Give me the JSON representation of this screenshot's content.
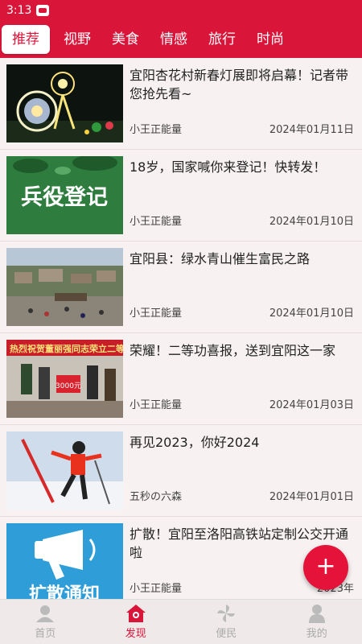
{
  "status_bar": {
    "time": "3:13"
  },
  "tabs": [
    {
      "label": "推荐",
      "active": true
    },
    {
      "label": "视野"
    },
    {
      "label": "美食"
    },
    {
      "label": "情感"
    },
    {
      "label": "旅行"
    },
    {
      "label": "时尚"
    }
  ],
  "articles": [
    {
      "title": "宜阳杏花村新春灯展即将启幕！记者带您抢先看~",
      "source": "小王正能量",
      "date": "2024年01月11日"
    },
    {
      "title": "18岁，国家喊你来登记！快转发！",
      "source": "小王正能量",
      "date": "2024年01月10日",
      "image_text": "兵役登记"
    },
    {
      "title": "宜阳县：绿水青山催生富民之路",
      "source": "小王正能量",
      "date": "2024年01月10日"
    },
    {
      "title": "荣耀！二等功喜报，送到宜阳这一家",
      "source": "小王正能量",
      "date": "2024年01月03日",
      "image_text": "热烈祝贺董丽强同志荣立二等功",
      "image_subtext": "3000元"
    },
    {
      "title": "再见2023，你好2024",
      "source": "五秒の六森",
      "date": "2024年01月01日"
    },
    {
      "title": "扩散！宜阳至洛阳高铁站定制公交开通啦",
      "source": "小王正能量",
      "date": "2023年",
      "image_text": "扩散通知"
    }
  ],
  "fab": {
    "label": "+"
  },
  "bottom_nav": [
    {
      "label": "首页",
      "icon": "home-person-icon"
    },
    {
      "label": "发现",
      "icon": "discover-house-icon",
      "active": true
    },
    {
      "label": "便民",
      "icon": "pinwheel-icon"
    },
    {
      "label": "我的",
      "icon": "profile-icon"
    }
  ],
  "colors": {
    "brand_red": "#d9153a",
    "background": "#f7f1f1",
    "inactive_gray": "#aaaaaa"
  }
}
